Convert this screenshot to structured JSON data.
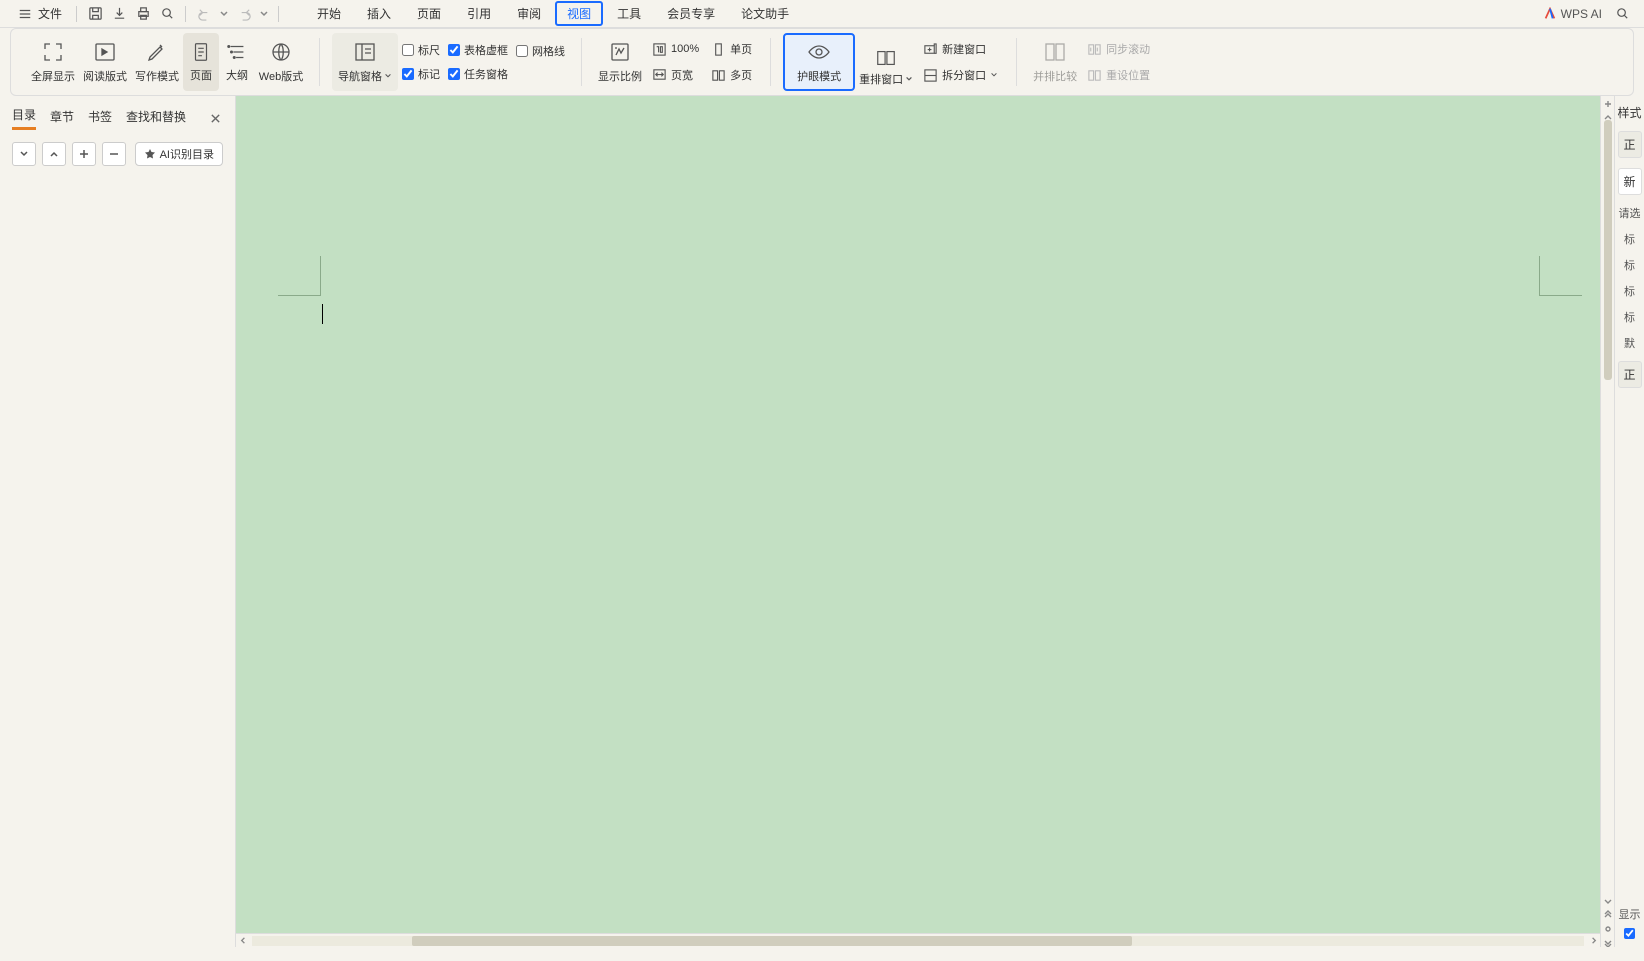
{
  "menubar": {
    "file": "文件",
    "tabs": [
      "开始",
      "插入",
      "页面",
      "引用",
      "审阅",
      "视图",
      "工具",
      "会员专享",
      "论文助手"
    ],
    "active_tab_index": 5,
    "wps_ai": "WPS AI"
  },
  "ribbon": {
    "view_modes": {
      "fullscreen": "全屏显示",
      "reading": "阅读版式",
      "writing": "写作模式",
      "page": "页面",
      "outline": "大纲",
      "web": "Web版式"
    },
    "nav_pane_btn": "导航窗格",
    "checks": {
      "ruler": "标尺",
      "table_border": "表格虚框",
      "gridlines": "网格线",
      "markup": "标记",
      "task_pane": "任务窗格"
    },
    "check_values": {
      "ruler": false,
      "table_border": true,
      "gridlines": false,
      "markup": true,
      "task_pane": true
    },
    "zoom": {
      "display_zoom": "显示比例",
      "hundred": "100%",
      "single_page": "单页",
      "page_width": "页宽",
      "multi_page": "多页"
    },
    "eye_protect": "护眼模式",
    "arrange": "重排窗口",
    "new_window": "新建窗口",
    "split": "拆分窗口",
    "side_by_side": "并排比较",
    "sync_scroll": "同步滚动",
    "reset_pos": "重设位置"
  },
  "nav": {
    "tabs": [
      "目录",
      "章节",
      "书签",
      "查找和替换"
    ],
    "active_index": 0,
    "ai_toc": "AI识别目录"
  },
  "styles_pane": {
    "title": "样式",
    "items": [
      "正",
      "新"
    ],
    "prompt": "请选",
    "headings": [
      "标",
      "标",
      "标",
      "标"
    ],
    "default": "默",
    "body": "正",
    "show": "显示",
    "chk": true
  }
}
